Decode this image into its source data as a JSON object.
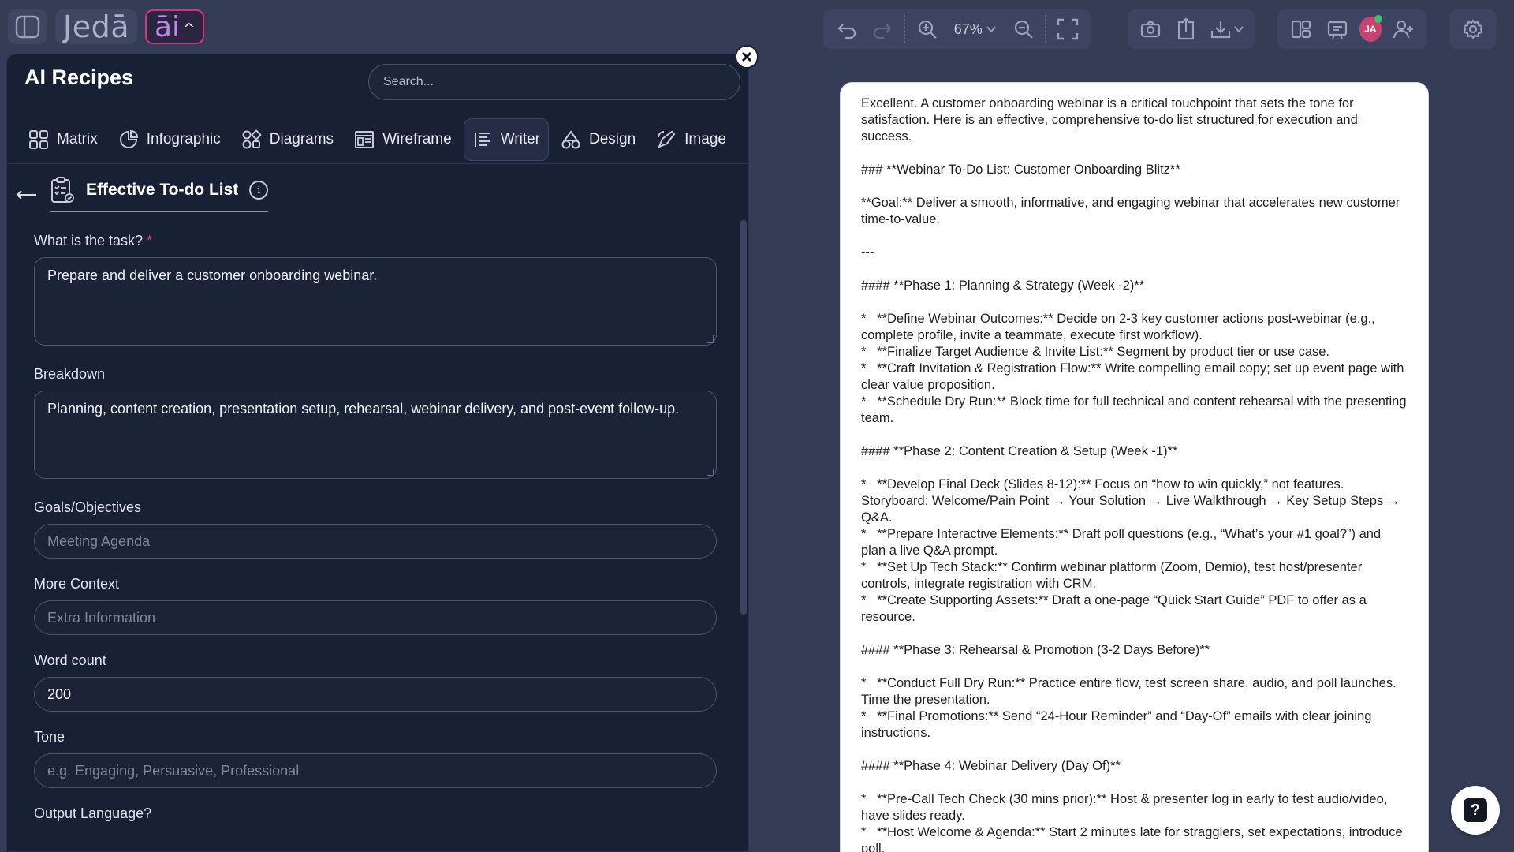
{
  "topbar": {
    "brand": "Jedā",
    "ai_label": "āi",
    "zoom": "67%"
  },
  "avatar_initials": "JA",
  "panel": {
    "title": "AI Recipes",
    "search_placeholder": "Search...",
    "tabs": [
      {
        "label": "Matrix",
        "icon": "matrix-icon"
      },
      {
        "label": "Infographic",
        "icon": "infographic-icon"
      },
      {
        "label": "Diagrams",
        "icon": "diagrams-icon"
      },
      {
        "label": "Wireframe",
        "icon": "wireframe-icon"
      },
      {
        "label": "Writer",
        "icon": "writer-icon",
        "active": true
      },
      {
        "label": "Design",
        "icon": "design-icon"
      },
      {
        "label": "Image",
        "icon": "image-icon"
      }
    ],
    "recipe_title": "Effective To-do List",
    "fields": {
      "task_label": "What is the task?",
      "task_required_mark": "*",
      "task_value": "Prepare and deliver a customer onboarding webinar.",
      "breakdown_label": "Breakdown",
      "breakdown_value": "Planning, content creation, presentation setup, rehearsal, webinar delivery, and post-event follow-up.",
      "goals_label": "Goals/Objectives",
      "goals_placeholder": "Meeting Agenda",
      "context_label": "More Context",
      "context_placeholder": "Extra Information",
      "wordcount_label": "Word count",
      "wordcount_value": "200",
      "tone_label": "Tone",
      "tone_placeholder": "e.g. Engaging, Persuasive, Professional",
      "output_label": "Output Language?"
    }
  },
  "document": {
    "paragraphs": [
      "Excellent. A customer onboarding webinar is a critical touchpoint that sets the tone for satisfaction. Here is an effective, comprehensive to-do list structured for execution and success.",
      "### **Webinar To-Do List: Customer Onboarding Blitz**",
      "**Goal:** Deliver a smooth, informative, and engaging webinar that accelerates new customer time-to-value.",
      "---",
      "#### **Phase 1: Planning & Strategy (Week -2)**",
      "*   **Define Webinar Outcomes:** Decide on 2-3 key customer actions post-webinar (e.g., complete profile, invite a teammate, execute first workflow).\n*   **Finalize Target Audience & Invite List:** Segment by product tier or use case.\n*   **Craft Invitation & Registration Flow:** Write compelling email copy; set up event page with clear value proposition.\n*   **Schedule Dry Run:** Block time for full technical and content rehearsal with the presenting team.",
      "#### **Phase 2: Content Creation & Setup (Week -1)**",
      "*   **Develop Final Deck (Slides 8-12):** Focus on “how to win quickly,” not features. Storyboard: Welcome/Pain Point → Your Solution → Live Walkthrough → Key Setup Steps → Q&A.\n*   **Prepare Interactive Elements:** Draft poll questions (e.g., “What’s your #1 goal?”) and plan a live Q&A prompt.\n*   **Set Up Tech Stack:** Confirm webinar platform (Zoom, Demio), test host/presenter controls, integrate registration with CRM.\n*   **Create Supporting Assets:** Draft a one-page “Quick Start Guide” PDF to offer as a resource.",
      "#### **Phase 3: Rehearsal & Promotion (3-2 Days Before)**",
      "*   **Conduct Full Dry Run:** Practice entire flow, test screen share, audio, and poll launches. Time the presentation.\n*   **Final Promotions:** Send “24-Hour Reminder” and “Day-Of” emails with clear joining instructions.",
      "#### **Phase 4: Webinar Delivery (Day Of)**",
      "*   **Pre-Call Tech Check (30 mins prior):** Host & presenter log in early to test audio/video, have slides ready.\n*   **Host Welcome & Agenda:** Start 2 minutes late for stragglers, set expectations, introduce poll."
    ]
  },
  "help_label": "?"
}
